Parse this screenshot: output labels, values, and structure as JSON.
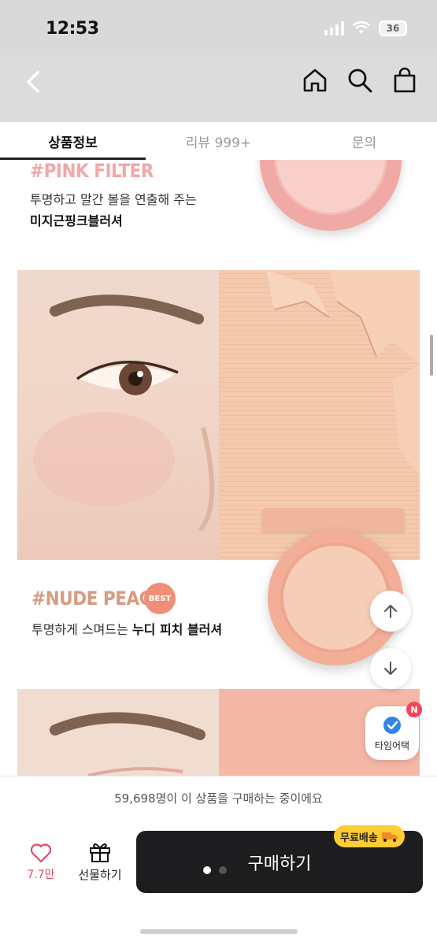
{
  "status_bar": {
    "time": "12:53",
    "battery": "36"
  },
  "header": {
    "back_icon": "chevron-left-icon",
    "home_icon": "home-icon",
    "search_icon": "search-icon",
    "cart_icon": "shopping-bag-icon"
  },
  "tabs": [
    {
      "label": "상품정보",
      "active": true
    },
    {
      "label": "리뷰 999+",
      "active": false
    },
    {
      "label": "문의",
      "active": false
    }
  ],
  "sections": {
    "pink_filter": {
      "title": "#PINK FILTER",
      "desc_line1": "투명하고 말간 볼을 연출해 주는",
      "desc_line2": "미지근핑크블러셔"
    },
    "nude_peach": {
      "title": "#NUDE PEACH",
      "badge": "BEST",
      "desc_plain": "투명하게 스며드는 ",
      "desc_bold": "누디 피치 블러셔"
    }
  },
  "floating": {
    "scroll_up_icon": "arrow-up-icon",
    "scroll_down_icon": "arrow-down-icon",
    "timedeal_label": "타임어택",
    "timedeal_badge": "N"
  },
  "purchase_banner": "59,698명이 이 상품을 구매하는 중이에요",
  "bottom_bar": {
    "like_count": "7.7만",
    "gift_label": "선물하기",
    "buy_label": "구매하기",
    "free_shipping": "무료배송"
  },
  "colors": {
    "pink_title": "#f2a7a8",
    "peach_title": "#d99a80",
    "accent_red": "#e24a63",
    "buy_button": "#1d1d1f",
    "free_ship_badge": "#ffcc33"
  }
}
